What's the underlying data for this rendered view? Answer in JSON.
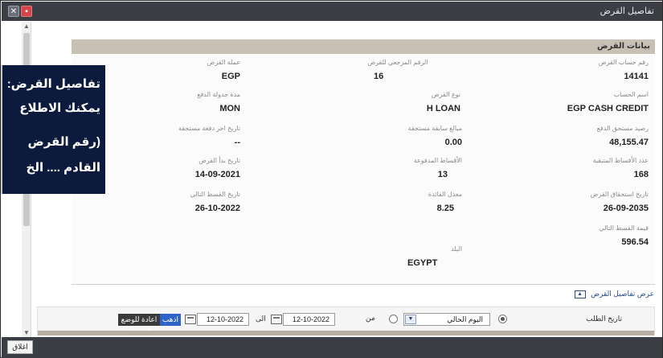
{
  "window": {
    "title": "تفاصيل القرض"
  },
  "section": {
    "header": "بيانات القرض",
    "toggle_label": "عرض تفاصيل القرض"
  },
  "fields": {
    "account_no": {
      "label": "رقم حساب القرض",
      "value": "14141"
    },
    "ref_no": {
      "label": "الرقم المرجعي للقرض",
      "value": "16"
    },
    "currency": {
      "label": "عملة القرض",
      "value": "EGP"
    },
    "account_name": {
      "label": "اسم الحساب",
      "value": "EGP CASH CREDIT"
    },
    "loan_type": {
      "label": "نوع القرض",
      "value": "H LOAN"
    },
    "schedule_period": {
      "label": "مدة جدولة الدفع",
      "value": "MON"
    },
    "outstanding": {
      "label": "رصيد مستحق الدفع",
      "value": "48,155.47"
    },
    "prepaid_amount": {
      "label": "مبالغ سابقة مستحقة",
      "value": "0.00"
    },
    "last_payment_date": {
      "label": "تاريخ اخر دفعة مستحقة",
      "value": "--"
    },
    "remaining_installments": {
      "label": "عدد الأقساط المتبقية",
      "value": "168"
    },
    "paid_installments": {
      "label": "الأقساط المدفوعة",
      "value": "13"
    },
    "start_date": {
      "label": "تاريخ بدأ القرض",
      "value": "14-09-2021"
    },
    "maturity_date": {
      "label": "تاريخ استحقاق القرض",
      "value": "26-09-2035"
    },
    "interest_rate": {
      "label": "معدل الفائدة",
      "value": "8.25"
    },
    "next_installment_date": {
      "label": "تاريخ القسط التالي",
      "value": "26-10-2022"
    },
    "next_installment_amount": {
      "label": "قيمة القسط التالي",
      "value": "596.54"
    },
    "country": {
      "label": "البلد",
      "value": "EGYPT"
    }
  },
  "search": {
    "request_date_label": "تاريخ الطلب",
    "period_selected": "اليوم الحالي",
    "from_label": "من",
    "from_date": "12-10-2022",
    "to_label": "الى",
    "to_date": "12-10-2022",
    "go_button": "اذهب",
    "reset_button": "اعادة للوضع السابق"
  },
  "footer": {
    "close_label": "اغلاق"
  },
  "tooltip": {
    "lines": [
      "تفاصيل القرض:",
      "يمكنك الاطلاع",
      "(رقم القرض",
      "القادم .... الخ"
    ]
  }
}
